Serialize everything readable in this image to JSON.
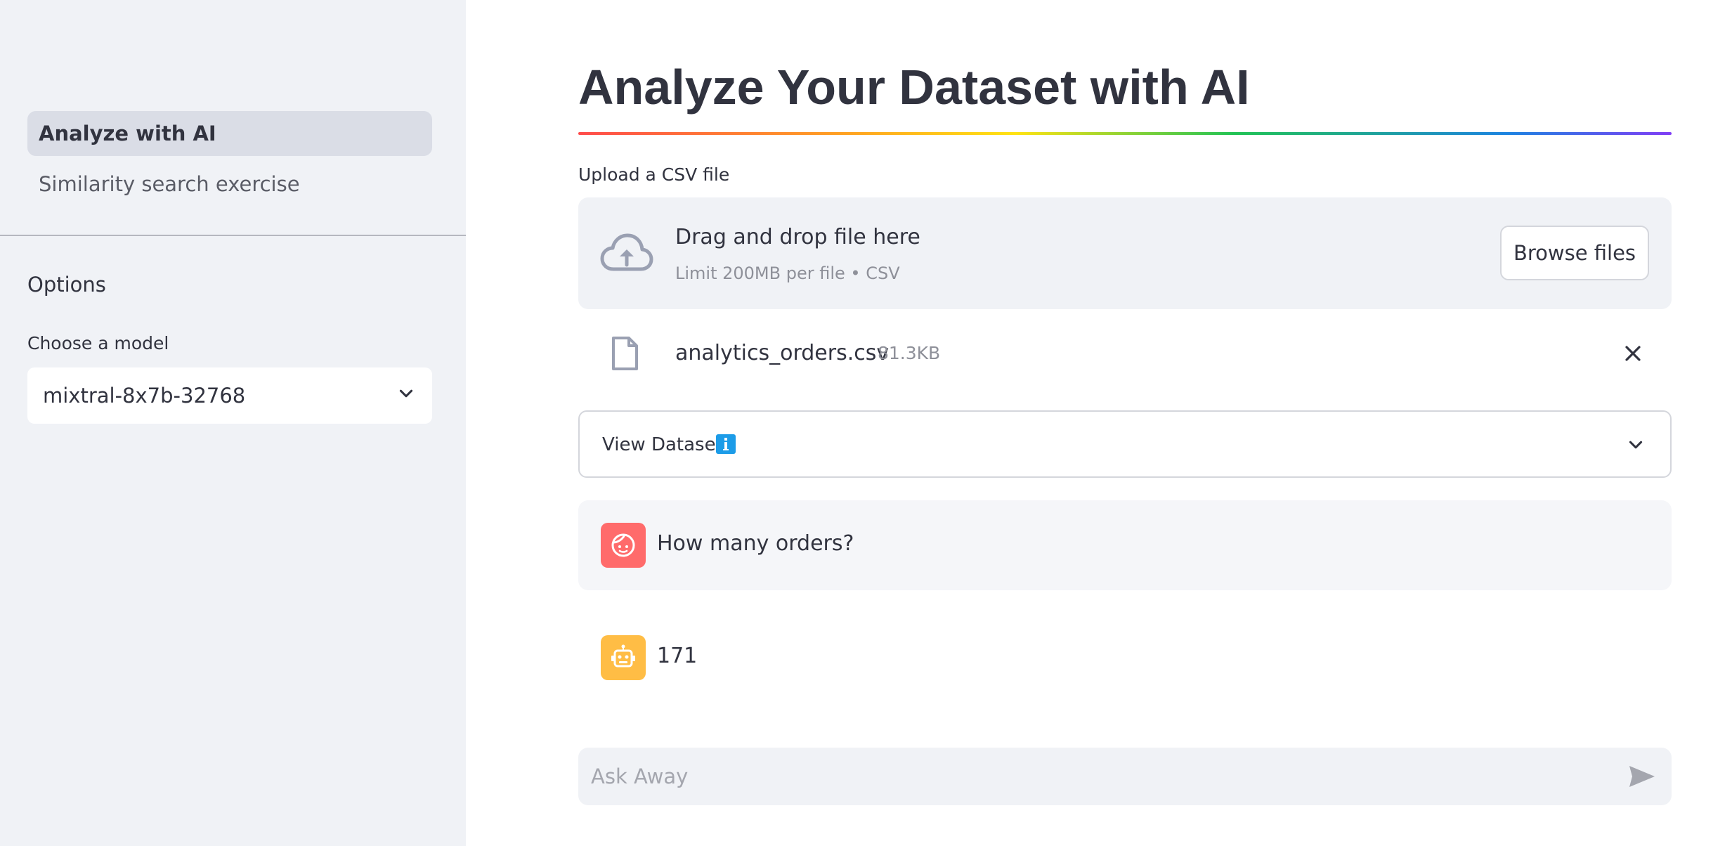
{
  "sidebar": {
    "nav": [
      {
        "label": "Analyze with AI",
        "active": true
      },
      {
        "label": "Similarity search exercise",
        "active": false
      }
    ],
    "options_title": "Options",
    "model_label": "Choose a model",
    "model_selected": "mixtral-8x7b-32768"
  },
  "main": {
    "title": "Analyze Your Dataset with AI",
    "uploader": {
      "label": "Upload a CSV file",
      "drop_title": "Drag and drop file here",
      "drop_limit": "Limit 200MB per file • CSV",
      "browse_label": "Browse files",
      "file_name": "analytics_orders.csv",
      "file_size": "81.3KB"
    },
    "expander": {
      "label": "View Dataset",
      "badge": "i"
    },
    "messages": [
      {
        "role": "user",
        "text": "How many orders?"
      },
      {
        "role": "assistant",
        "text": "171"
      }
    ],
    "chat_input": {
      "placeholder": "Ask Away"
    }
  },
  "icons": {
    "upload": "cloud-upload-icon",
    "file": "file-icon",
    "remove": "close-icon",
    "expander": "chevron-down-icon",
    "user_avatar": "user-face-icon",
    "bot_avatar": "robot-icon",
    "send": "send-icon"
  },
  "colors": {
    "sidebar_bg": "#f0f2f6",
    "user_avatar": "#ff6b6b",
    "bot_avatar": "#ffbd45",
    "info_badge": "#1c9ce8"
  }
}
